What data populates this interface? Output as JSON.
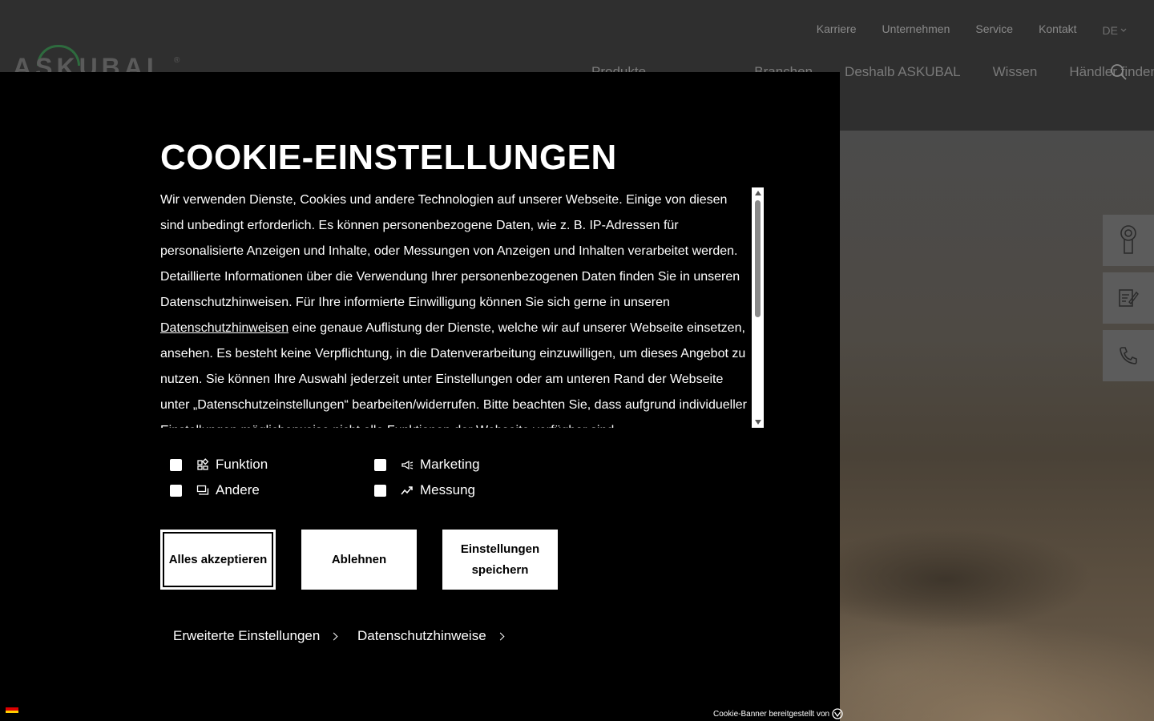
{
  "logo": {
    "text": "ASKUBAL",
    "reg": "®"
  },
  "top_nav": {
    "items": [
      "Karriere",
      "Unternehmen",
      "Service",
      "Kontakt"
    ],
    "language": "DE"
  },
  "main_nav": {
    "items": [
      "Produkte",
      "Branchen",
      "Deshalb ASKUBAL",
      "Wissen",
      "Händler finden"
    ]
  },
  "side_tools": [
    "location-pin-icon",
    "edit-form-icon",
    "phone-icon"
  ],
  "cookie": {
    "title": "COOKIE-EINSTELLUNGEN",
    "text_part1": "Wir verwenden Dienste, Cookies und andere Technologien auf unserer Webseite. Einige von diesen sind unbedingt erforderlich. Es können personenbezogene Daten, wie z. B. IP-Adressen für personalisierte Anzeigen und Inhalte, oder Messungen von Anzeigen und Inhalten verarbeitet werden. Detaillierte Informationen über die Verwendung Ihrer personenbezogenen Daten finden Sie in unseren Datenschutzhinweisen. Für Ihre informierte Einwilligung können Sie sich gerne in unseren ",
    "text_link": "Datenschutzhinweisen",
    "text_part2": " eine genaue Auflistung der Dienste, welche wir auf unserer Webseite einsetzen, ansehen. Es besteht keine Verpflichtung, in die Datenverarbeitung einzuwilligen, um dieses Angebot zu nutzen. Sie können Ihre Auswahl jederzeit unter Einstellungen oder am unteren Rand der Webseite unter „Datenschutzeinstellungen“ bearbeiten/widerrufen. Bitte beachten Sie, dass aufgrund individueller Einstellungen möglicherweise nicht alle Funktionen der Webseite verfügbar sind.",
    "options": [
      {
        "label": "Funktion",
        "icon": "puzzle-icon",
        "checked": false
      },
      {
        "label": "Marketing",
        "icon": "megaphone-icon",
        "checked": false
      },
      {
        "label": "Andere",
        "icon": "chat-icon",
        "checked": false
      },
      {
        "label": "Messung",
        "icon": "trend-icon",
        "checked": false
      }
    ],
    "buttons": {
      "accept": "Alles akzeptieren",
      "decline": "Ablehnen",
      "save_line1": "Einstellungen",
      "save_line2": "speichern"
    },
    "links": {
      "advanced": "Erweiterte Einstellungen",
      "privacy": "Datenschutzhinweise"
    },
    "provided_by": "Cookie-Banner bereitgestellt von"
  },
  "colors": {
    "panel": "#000000",
    "accent_green": "#2e6b3e",
    "header_bg": "#2f2f2f"
  }
}
